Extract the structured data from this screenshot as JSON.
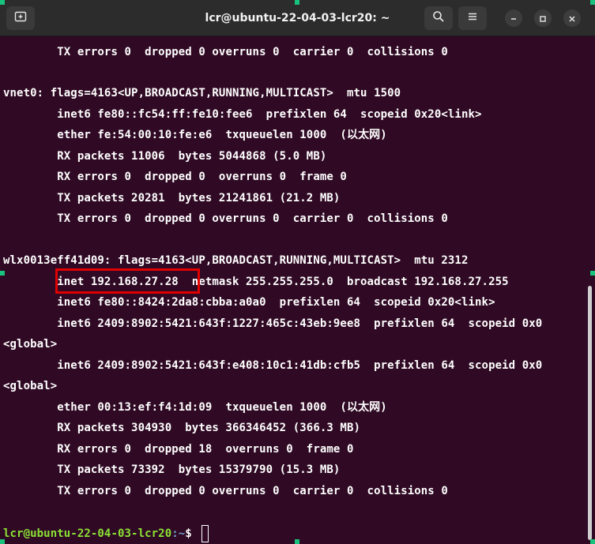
{
  "window": {
    "title": "lcr@ubuntu-22-04-03-lcr20: ~"
  },
  "icons": {
    "new_tab": "new-tab-icon",
    "search": "search-icon",
    "menu": "hamburger-menu-icon",
    "minimize": "minimize-icon",
    "maximize": "maximize-icon",
    "close": "close-icon"
  },
  "terminal": {
    "lines": [
      "        TX errors 0  dropped 0 overruns 0  carrier 0  collisions 0",
      "",
      "vnet0: flags=4163<UP,BROADCAST,RUNNING,MULTICAST>  mtu 1500",
      "        inet6 fe80::fc54:ff:fe10:fee6  prefixlen 64  scopeid 0x20<link>",
      "        ether fe:54:00:10:fe:e6  txqueuelen 1000  (以太网)",
      "        RX packets 11006  bytes 5044868 (5.0 MB)",
      "        RX errors 0  dropped 0  overruns 0  frame 0",
      "        TX packets 20281  bytes 21241861 (21.2 MB)",
      "        TX errors 0  dropped 0 overruns 0  carrier 0  collisions 0",
      "",
      "wlx0013eff41d09: flags=4163<UP,BROADCAST,RUNNING,MULTICAST>  mtu 2312",
      "        inet 192.168.27.28  netmask 255.255.255.0  broadcast 192.168.27.255",
      "        inet6 fe80::8424:2da8:cbba:a0a0  prefixlen 64  scopeid 0x20<link>",
      "        inet6 2409:8902:5421:643f:1227:465c:43eb:9ee8  prefixlen 64  scopeid 0x0",
      "<global>",
      "        inet6 2409:8902:5421:643f:e408:10c1:41db:cfb5  prefixlen 64  scopeid 0x0",
      "<global>",
      "        ether 00:13:ef:f4:1d:09  txqueuelen 1000  (以太网)",
      "        RX packets 304930  bytes 366346452 (366.3 MB)",
      "        RX errors 0  dropped 18  overruns 0  frame 0",
      "        TX packets 73392  bytes 15379790 (15.3 MB)",
      "        TX errors 0  dropped 0 overruns 0  carrier 0  collisions 0",
      ""
    ],
    "prompt_user": "lcr@ubuntu-22-04-03-lcr20",
    "prompt_path": ":~",
    "prompt_symbol": "$ "
  },
  "colors": {
    "terminal_bg": "#300a24",
    "highlight": "#e00000",
    "prompt_user": "#8ae234",
    "prompt_path": "#729fcf"
  }
}
